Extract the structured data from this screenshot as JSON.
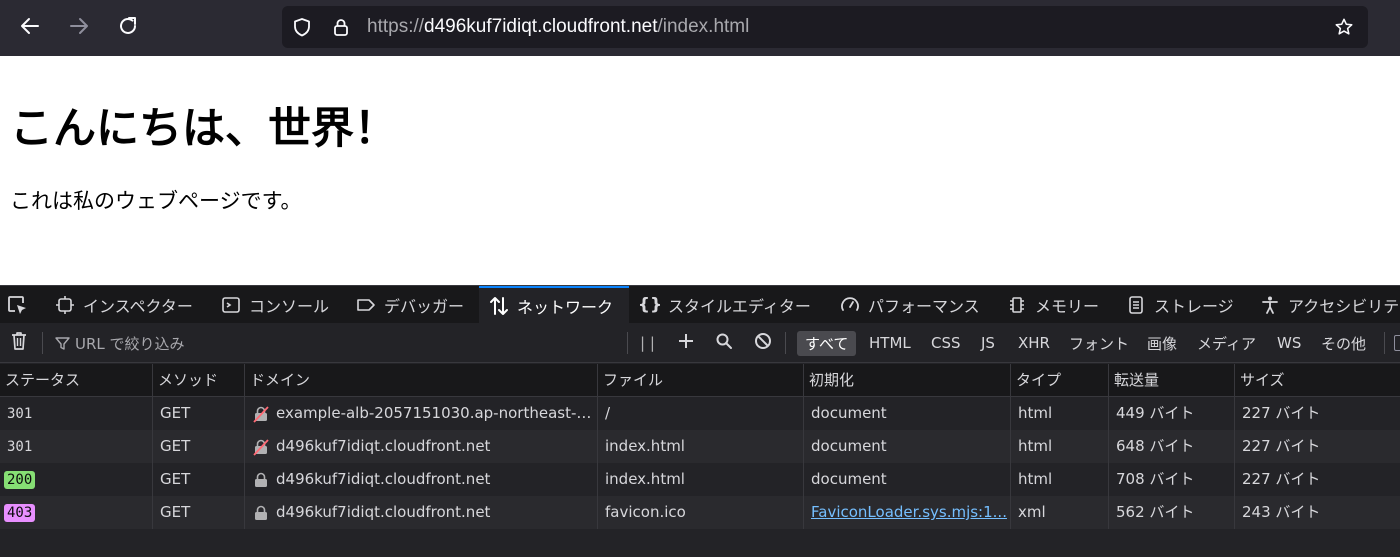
{
  "browser": {
    "url_scheme": "https://",
    "url_host": "d496kuf7idiqt.cloudfront.net",
    "url_path": "/index.html",
    "icons": [
      "back-arrow-icon",
      "forward-arrow-icon",
      "reload-icon",
      "shield-icon",
      "lock-icon",
      "bookmark-star-icon"
    ]
  },
  "page": {
    "heading": "こんにちは、世界！",
    "paragraph": "これは私のウェブページです。"
  },
  "devtools": {
    "tabs": [
      {
        "label": "インスペクター",
        "icon": "inspector-icon"
      },
      {
        "label": "コンソール",
        "icon": "console-icon"
      },
      {
        "label": "デバッガー",
        "icon": "debugger-icon"
      },
      {
        "label": "ネットワーク",
        "icon": "network-icon",
        "active": true
      },
      {
        "label": "スタイルエディター",
        "icon": "braces-icon"
      },
      {
        "label": "パフォーマンス",
        "icon": "gauge-icon"
      },
      {
        "label": "メモリー",
        "icon": "memory-chip-icon"
      },
      {
        "label": "ストレージ",
        "icon": "storage-icon"
      },
      {
        "label": "アクセシビリティ",
        "icon": "accessibility-icon"
      }
    ],
    "filter": {
      "placeholder": "URL で絞り込み",
      "types": [
        "すべて",
        "HTML",
        "CSS",
        "JS",
        "XHR",
        "フォント",
        "画像",
        "メディア",
        "WS",
        "その他"
      ],
      "active_type": "すべて"
    },
    "columns": [
      "ステータス",
      "メソッド",
      "ドメイン",
      "ファイル",
      "初期化",
      "タイプ",
      "転送量",
      "サイズ"
    ],
    "rows": [
      {
        "status": "301",
        "method": "GET",
        "domain": "example-alb-2057151030.ap-northeast-1....",
        "domain_icon": "insecure-lock-icon",
        "file": "/",
        "initiator": "document",
        "type": "html",
        "transferred": "449 バイト",
        "size": "227 バイト"
      },
      {
        "status": "301",
        "method": "GET",
        "domain": "d496kuf7idiqt.cloudfront.net",
        "domain_icon": "insecure-lock-icon",
        "file": "index.html",
        "initiator": "document",
        "type": "html",
        "transferred": "648 バイト",
        "size": "227 バイト"
      },
      {
        "status": "200",
        "method": "GET",
        "domain": "d496kuf7idiqt.cloudfront.net",
        "domain_icon": "lock-icon",
        "file": "index.html",
        "initiator": "document",
        "type": "html",
        "transferred": "708 バイト",
        "size": "227 バイト",
        "status_color": "#86de74"
      },
      {
        "status": "403",
        "method": "GET",
        "domain": "d496kuf7idiqt.cloudfront.net",
        "domain_icon": "lock-icon",
        "file": "favicon.ico",
        "initiator": "FaviconLoader.sys.mjs:1...",
        "initiator_is_link": true,
        "type": "xml",
        "transferred": "562 バイト",
        "size": "243 バイト",
        "status_color": "#e88fff"
      }
    ]
  }
}
